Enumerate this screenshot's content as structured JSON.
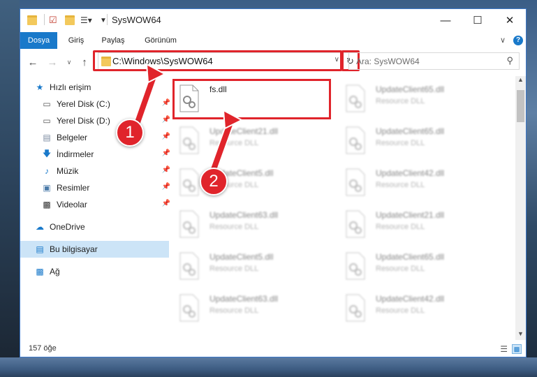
{
  "window": {
    "title": "SysWOW64"
  },
  "ribbon": {
    "tabs": [
      "Dosya",
      "Giriş",
      "Paylaş",
      "Görünüm"
    ]
  },
  "address": {
    "path": "C:\\Windows\\SysWOW64"
  },
  "search": {
    "placeholder": "Ara: SysWOW64"
  },
  "sidebar": {
    "items": [
      {
        "label": "Hızlı erişim",
        "icon": "star-icon"
      },
      {
        "label": "Yerel Disk (C:)",
        "icon": "drive-icon"
      },
      {
        "label": "Yerel Disk (D:)",
        "icon": "drive-icon"
      },
      {
        "label": "Belgeler",
        "icon": "document-icon"
      },
      {
        "label": "İndirmeler",
        "icon": "download-icon"
      },
      {
        "label": "Müzik",
        "icon": "music-icon"
      },
      {
        "label": "Resimler",
        "icon": "picture-icon"
      },
      {
        "label": "Videolar",
        "icon": "video-icon"
      },
      {
        "label": "OneDrive",
        "icon": "cloud-icon"
      },
      {
        "label": "Bu bilgisayar",
        "icon": "computer-icon"
      },
      {
        "label": "Ağ",
        "icon": "network-icon"
      }
    ]
  },
  "files": [
    {
      "name": "fs.dll",
      "type": ""
    },
    {
      "name": "UpdateClient65.dll",
      "type": "Resource DLL"
    },
    {
      "name": "UpdateClient21.dll",
      "type": "Resource DLL"
    },
    {
      "name": "UpdateClient65.dll",
      "type": "Resource DLL"
    },
    {
      "name": "UpdateClient5.dll",
      "type": "Resource DLL"
    },
    {
      "name": "UpdateClient42.dll",
      "type": "Resource DLL"
    },
    {
      "name": "UpdateClient63.dll",
      "type": "Resource DLL"
    },
    {
      "name": "UpdateClient21.dll",
      "type": "Resource DLL"
    },
    {
      "name": "UpdateClient5.dll",
      "type": "Resource DLL"
    },
    {
      "name": "UpdateClient65.dll",
      "type": "Resource DLL"
    },
    {
      "name": "UpdateClient63.dll",
      "type": "Resource DLL"
    },
    {
      "name": "UpdateClient42.dll",
      "type": "Resource DLL"
    }
  ],
  "status": {
    "count": "157 öğe"
  },
  "callouts": [
    "1",
    "2"
  ],
  "colors": {
    "accent": "#1979ca",
    "highlight": "#e0242b"
  }
}
